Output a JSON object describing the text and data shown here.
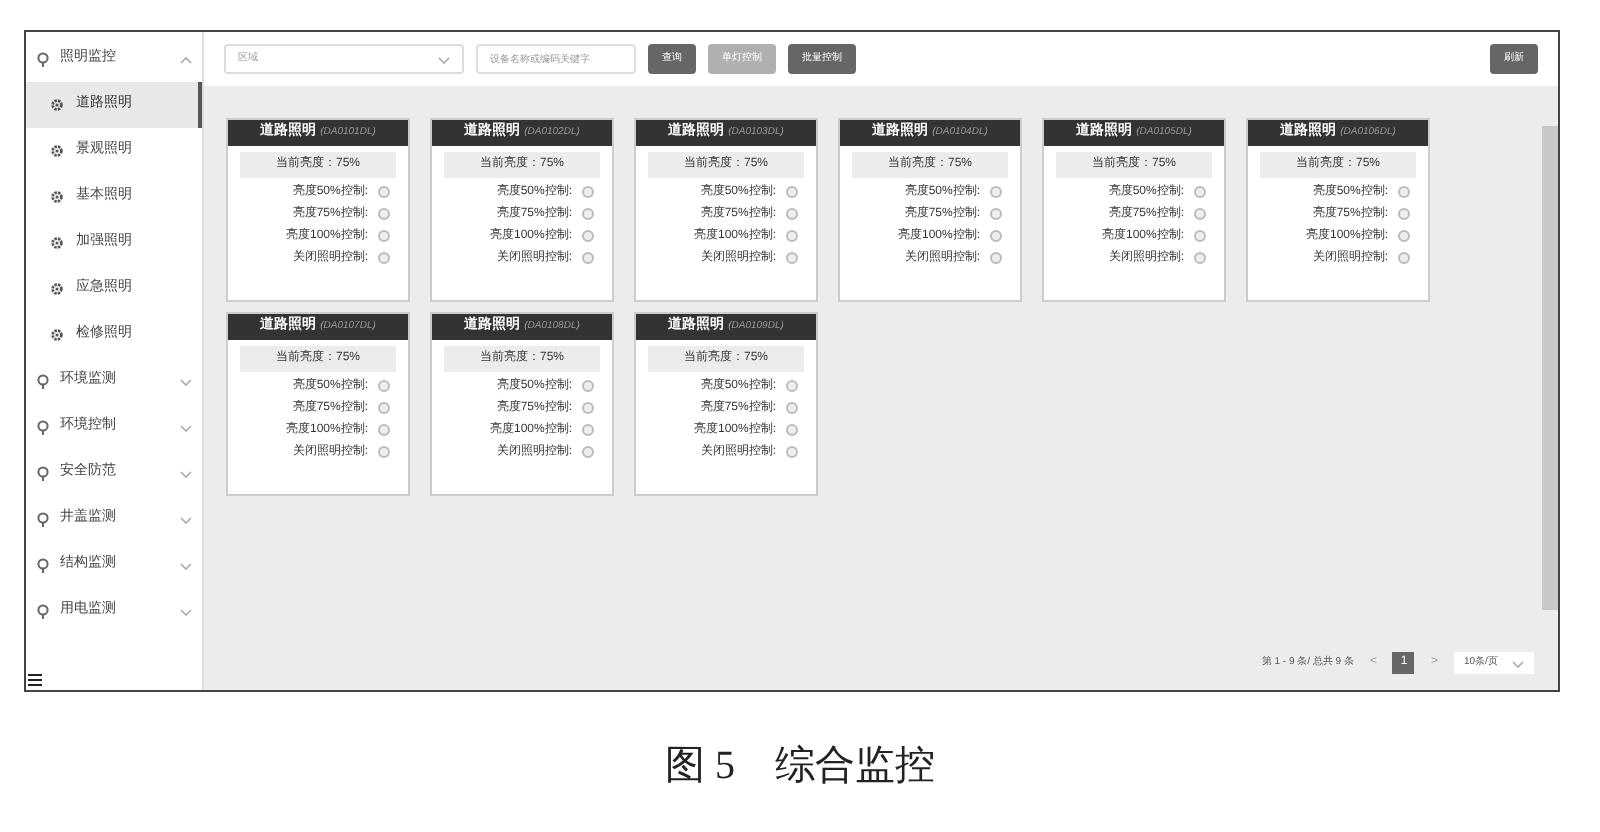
{
  "sidebar": {
    "items": [
      {
        "label": "照明监控",
        "expanded": true,
        "children": [
          {
            "label": "道路照明",
            "selected": true
          },
          {
            "label": "景观照明",
            "selected": false
          },
          {
            "label": "基本照明",
            "selected": false
          },
          {
            "label": "加强照明",
            "selected": false
          },
          {
            "label": "应急照明",
            "selected": false
          },
          {
            "label": "检修照明",
            "selected": false
          }
        ]
      },
      {
        "label": "环境监测",
        "expanded": false
      },
      {
        "label": "环境控制",
        "expanded": false
      },
      {
        "label": "安全防范",
        "expanded": false
      },
      {
        "label": "井盖监测",
        "expanded": false
      },
      {
        "label": "结构监测",
        "expanded": false
      },
      {
        "label": "用电监测",
        "expanded": false
      }
    ]
  },
  "toolbar": {
    "region_select": {
      "placeholder": "区域"
    },
    "search": {
      "placeholder": "设备名称或编码关键字"
    },
    "buttons": [
      {
        "label": "查询",
        "disabled": false
      },
      {
        "label": "单灯控制",
        "disabled": true
      },
      {
        "label": "批量控制",
        "disabled": false
      }
    ],
    "refresh": "刷新"
  },
  "cards": [
    {
      "title": "道路照明",
      "code": "(DA0101DL)",
      "brightness": "当前亮度：75%",
      "controls": [
        {
          "label": "亮度50%控制:",
          "checked": false
        },
        {
          "label": "亮度75%控制:",
          "checked": false
        },
        {
          "label": "亮度100%控制:",
          "checked": false
        },
        {
          "label": "关闭照明控制:",
          "checked": false
        }
      ]
    },
    {
      "title": "道路照明",
      "code": "(DA0102DL)",
      "brightness": "当前亮度：75%",
      "controls": [
        {
          "label": "亮度50%控制:",
          "checked": false
        },
        {
          "label": "亮度75%控制:",
          "checked": false
        },
        {
          "label": "亮度100%控制:",
          "checked": false
        },
        {
          "label": "关闭照明控制:",
          "checked": false
        }
      ]
    },
    {
      "title": "道路照明",
      "code": "(DA0103DL)",
      "brightness": "当前亮度：75%",
      "controls": [
        {
          "label": "亮度50%控制:",
          "checked": false
        },
        {
          "label": "亮度75%控制:",
          "checked": false
        },
        {
          "label": "亮度100%控制:",
          "checked": false
        },
        {
          "label": "关闭照明控制:",
          "checked": false
        }
      ]
    },
    {
      "title": "道路照明",
      "code": "(DA0104DL)",
      "brightness": "当前亮度：75%",
      "controls": [
        {
          "label": "亮度50%控制:",
          "checked": false
        },
        {
          "label": "亮度75%控制:",
          "checked": false
        },
        {
          "label": "亮度100%控制:",
          "checked": false
        },
        {
          "label": "关闭照明控制:",
          "checked": false
        }
      ]
    },
    {
      "title": "道路照明",
      "code": "(DA0105DL)",
      "brightness": "当前亮度：75%",
      "controls": [
        {
          "label": "亮度50%控制:",
          "checked": false
        },
        {
          "label": "亮度75%控制:",
          "checked": false
        },
        {
          "label": "亮度100%控制:",
          "checked": false
        },
        {
          "label": "关闭照明控制:",
          "checked": false
        }
      ]
    },
    {
      "title": "道路照明",
      "code": "(DA0106DL)",
      "brightness": "当前亮度：75%",
      "controls": [
        {
          "label": "亮度50%控制:",
          "checked": false
        },
        {
          "label": "亮度75%控制:",
          "checked": false
        },
        {
          "label": "亮度100%控制:",
          "checked": false
        },
        {
          "label": "关闭照明控制:",
          "checked": false
        }
      ]
    },
    {
      "title": "道路照明",
      "code": "(DA0107DL)",
      "brightness": "当前亮度：75%",
      "controls": [
        {
          "label": "亮度50%控制:",
          "checked": false
        },
        {
          "label": "亮度75%控制:",
          "checked": false
        },
        {
          "label": "亮度100%控制:",
          "checked": false
        },
        {
          "label": "关闭照明控制:",
          "checked": false
        }
      ]
    },
    {
      "title": "道路照明",
      "code": "(DA0108DL)",
      "brightness": "当前亮度：75%",
      "controls": [
        {
          "label": "亮度50%控制:",
          "checked": false
        },
        {
          "label": "亮度75%控制:",
          "checked": false
        },
        {
          "label": "亮度100%控制:",
          "checked": false
        },
        {
          "label": "关闭照明控制:",
          "checked": false
        }
      ]
    },
    {
      "title": "道路照明",
      "code": "(DA0109DL)",
      "brightness": "当前亮度：75%",
      "controls": [
        {
          "label": "亮度50%控制:",
          "checked": false
        },
        {
          "label": "亮度75%控制:",
          "checked": false
        },
        {
          "label": "亮度100%控制:",
          "checked": false
        },
        {
          "label": "关闭照明控制:",
          "checked": false
        }
      ]
    }
  ],
  "pagination": {
    "summary": "第 1 - 9 条/ 总共 9 条",
    "prev": "<",
    "pages": [
      {
        "label": "1",
        "selected": true
      }
    ],
    "next": ">",
    "page_size": "10条/页"
  },
  "caption": "图 5　综合监控"
}
